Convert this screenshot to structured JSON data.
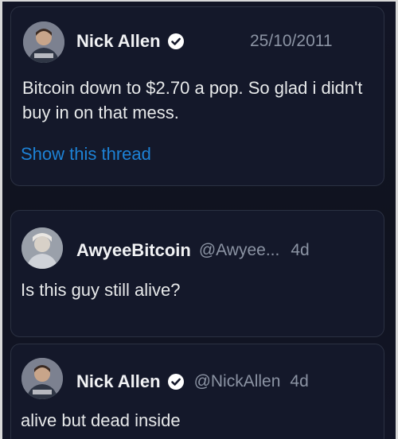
{
  "tweets": [
    {
      "author": "Nick Allen",
      "verified": true,
      "date": "25/10/2011",
      "text": "Bitcoin down to $2.70 a pop. So glad i didn't buy in on that mess.",
      "thread_link": "Show this thread"
    },
    {
      "author": "AwyeeBitcoin",
      "handle": "@Awyee...",
      "time": "4d",
      "text": "Is this guy still alive?"
    },
    {
      "author": "Nick Allen",
      "verified": true,
      "handle": "@NickAllen",
      "time": "4d",
      "text": "alive but dead inside"
    }
  ],
  "colors": {
    "background": "#10131f",
    "link": "#1d82d6",
    "muted": "#8b93a3",
    "verified": "#ffffff"
  }
}
